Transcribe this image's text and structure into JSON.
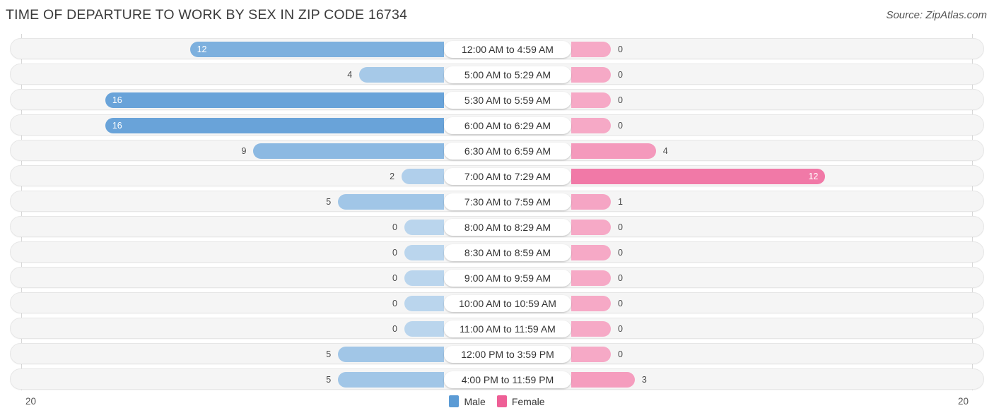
{
  "header": {
    "title": "TIME OF DEPARTURE TO WORK BY SEX IN ZIP CODE 16734",
    "source": "Source: ZipAtlas.com"
  },
  "axis": {
    "left_end_label": "20",
    "right_end_label": "20",
    "max": 20
  },
  "legend": {
    "items": [
      {
        "label": "Male",
        "color": "#5b9bd5"
      },
      {
        "label": "Female",
        "color": "#ee5f96"
      }
    ]
  },
  "chart_data": {
    "type": "bar",
    "title": "TIME OF DEPARTURE TO WORK BY SEX IN ZIP CODE 16734",
    "subtitle": "",
    "orientation": "horizontal-diverging",
    "xlabel": "",
    "ylabel": "",
    "xlim": [
      20,
      20
    ],
    "grid": false,
    "legend_position": "bottom-center",
    "categories": [
      "12:00 AM to 4:59 AM",
      "5:00 AM to 5:29 AM",
      "5:30 AM to 5:59 AM",
      "6:00 AM to 6:29 AM",
      "6:30 AM to 6:59 AM",
      "7:00 AM to 7:29 AM",
      "7:30 AM to 7:59 AM",
      "8:00 AM to 8:29 AM",
      "8:30 AM to 8:59 AM",
      "9:00 AM to 9:59 AM",
      "10:00 AM to 10:59 AM",
      "11:00 AM to 11:59 AM",
      "12:00 PM to 3:59 PM",
      "4:00 PM to 11:59 PM"
    ],
    "series": [
      {
        "name": "Male",
        "color": "#5b9bd5",
        "direction": "left",
        "values": [
          12,
          4,
          16,
          16,
          9,
          2,
          5,
          0,
          0,
          0,
          0,
          0,
          5,
          5
        ]
      },
      {
        "name": "Female",
        "color": "#ee5f96",
        "direction": "right",
        "values": [
          0,
          0,
          0,
          0,
          4,
          12,
          1,
          0,
          0,
          0,
          0,
          0,
          0,
          3
        ]
      }
    ]
  }
}
